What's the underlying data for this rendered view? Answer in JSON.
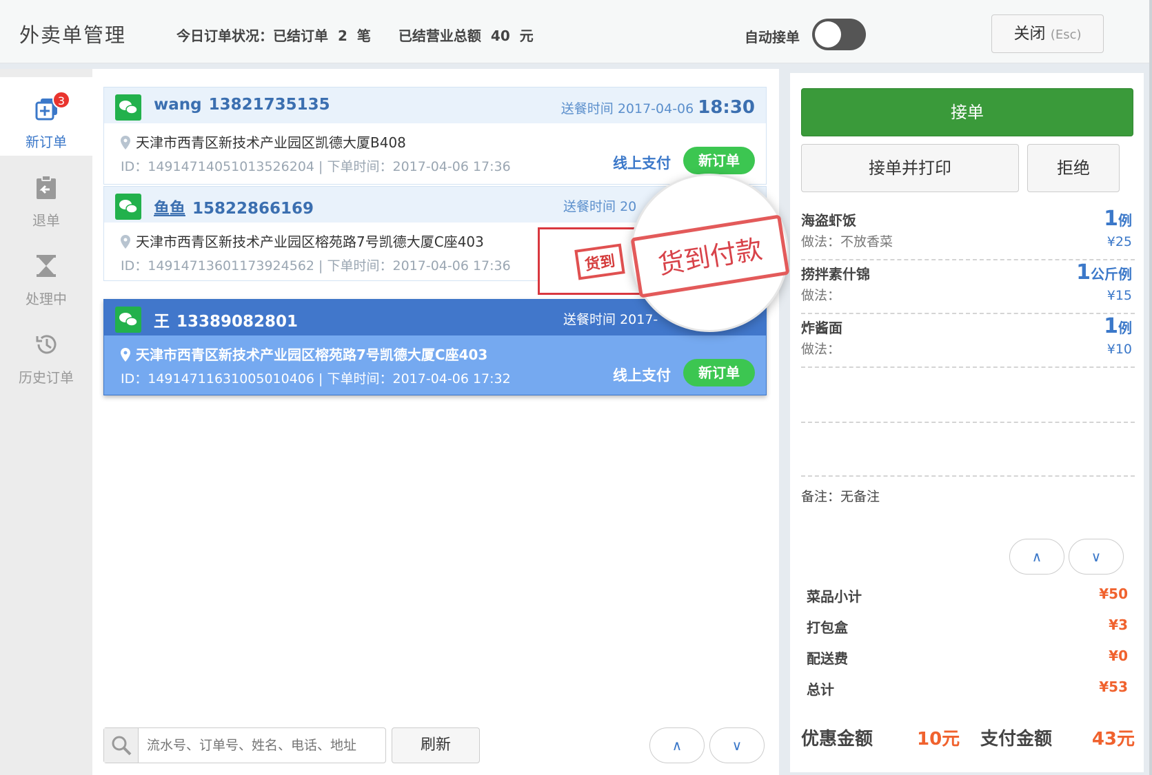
{
  "header": {
    "title": "外卖单管理",
    "stats_prefix": "今日订单状况：已结订单",
    "orders_count": "2",
    "orders_unit": "笔",
    "revenue_label": "已结营业总额",
    "revenue_value": "40",
    "revenue_unit": "元",
    "auto_accept_label": "自动接单",
    "close_label": "关闭",
    "close_hint": "(Esc)"
  },
  "sidebar": {
    "items": [
      {
        "label": "新订单",
        "icon": "new-order-icon",
        "badge": "3"
      },
      {
        "label": "退单",
        "icon": "return-order-icon"
      },
      {
        "label": "处理中",
        "icon": "hourglass-icon"
      },
      {
        "label": "历史订单",
        "icon": "history-icon"
      }
    ]
  },
  "orders": [
    {
      "name": "wang",
      "phone": "13821735135",
      "delivery_label": "送餐时间",
      "delivery_date": "2017-04-06",
      "delivery_time": "18:30",
      "address": "天津市西青区新技术产业园区凯德大厦B408",
      "meta": "ID：14914714051013526204 | 下单时间：2017-04-06 17:36",
      "payment": "线上支付",
      "status": "新订单"
    },
    {
      "name": "鱼鱼",
      "phone": "15822866169",
      "delivery_label": "送餐时间",
      "delivery_date": "20",
      "address": "天津市西青区新技术产业园区榕苑路7号凯德大厦C座403",
      "meta": "ID：14914713601173924562 | 下单时间：2017-04-06 17:36"
    },
    {
      "name": "王",
      "phone": "13389082801",
      "delivery_label": "送餐时间",
      "delivery_date": "2017-",
      "address": "天津市西青区新技术产业园区榕苑路7号凯德大厦C座403",
      "meta": "ID：14914711631005010406 | 下单时间：2017-04-06 17:32",
      "payment": "线上支付",
      "status": "新订单"
    }
  ],
  "stamp": {
    "small": "货到",
    "big": "货到付款"
  },
  "search": {
    "placeholder": "流水号、订单号、姓名、电话、地址",
    "refresh_label": "刷新"
  },
  "pager": {
    "up": "∧",
    "down": "∨"
  },
  "detail": {
    "accept_label": "接单",
    "accept_print_label": "接单并打印",
    "reject_label": "拒绝",
    "items": [
      {
        "name": "海盗虾饭",
        "qty": "1",
        "unit": "例",
        "note": "做法：不放香菜",
        "price": "¥25"
      },
      {
        "name": "捞拌素什锦",
        "qty": "1",
        "unit": "公斤例",
        "note": "做法：",
        "price": "¥15"
      },
      {
        "name": "炸酱面",
        "qty": "1",
        "unit": "例",
        "note": "做法：",
        "price": "¥10"
      }
    ],
    "remark": "备注：无备注",
    "summary": [
      {
        "label": "菜品小计",
        "value": "¥50"
      },
      {
        "label": "打包盒",
        "value": "¥3"
      },
      {
        "label": "配送费",
        "value": "¥0"
      },
      {
        "label": "总计",
        "value": "¥53"
      }
    ],
    "discount_label": "优惠金额",
    "discount_value": "10元",
    "pay_label": "支付金额",
    "pay_value": "43元"
  },
  "colors": {
    "accent": "#3b78c9",
    "accept_green": "#3a9a3a",
    "status_green": "#3cc651",
    "price_orange": "#f0622e",
    "selected_blue": "#4177cb",
    "stamp_red": "#d8434a"
  }
}
